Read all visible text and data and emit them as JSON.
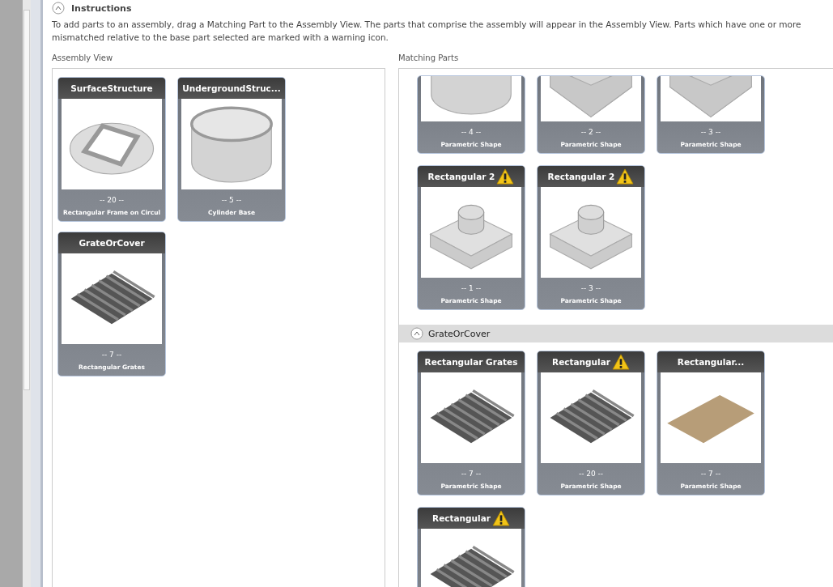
{
  "instructions": {
    "title": "Instructions",
    "expanded": true,
    "text": "To add parts to an assembly, drag a Matching Part to the Assembly View. The parts that comprise the assembly will appear in the Assembly View. Parts which have one or more mismatched relative to the base part selected are marked with a warning icon."
  },
  "assembly_view": {
    "label": "Assembly View",
    "parts": [
      {
        "title": "SurfaceStructure",
        "kind": "frame",
        "count": "-- 20 --",
        "type": "Rectangular Frame on Circul",
        "warning": false
      },
      {
        "title": "UndergroundStruc...",
        "kind": "cylinder",
        "count": "-- 5 --",
        "type": "Cylinder Base",
        "warning": false
      },
      {
        "title": "GrateOrCover",
        "kind": "grate",
        "count": "-- 7 --",
        "type": "Rectangular Grates",
        "warning": false
      }
    ]
  },
  "matching_parts": {
    "label": "Matching Parts",
    "groups": [
      {
        "parts": [
          {
            "kind": "cylinder",
            "count": "-- 4 --",
            "type": "Parametric Shape"
          },
          {
            "kind": "box",
            "count": "-- 2 --",
            "type": "Parametric Shape"
          },
          {
            "kind": "box",
            "count": "-- 3 --",
            "type": "Parametric Shape"
          },
          {
            "title": "Rectangular 2",
            "kind": "boxcylinder",
            "count": "-- 1 --",
            "type": "Parametric Shape",
            "warning": true
          },
          {
            "title": "Rectangular 2",
            "kind": "boxcylinder",
            "count": "-- 3 --",
            "type": "Parametric Shape",
            "warning": true
          }
        ]
      },
      {
        "name": "GrateOrCover",
        "expanded": true,
        "parts": [
          {
            "title": "Rectangular Grates",
            "kind": "grate",
            "count": "-- 7 --",
            "type": "Parametric Shape",
            "warning": false
          },
          {
            "title": "Rectangular",
            "kind": "grate",
            "count": "-- 20 --",
            "type": "Parametric Shape",
            "warning": true
          },
          {
            "title": "Rectangular...",
            "kind": "plate",
            "count": "-- 7 --",
            "type": "Parametric Shape",
            "warning": false
          },
          {
            "title": "Rectangular",
            "kind": "grate",
            "warning": true
          }
        ]
      }
    ]
  }
}
